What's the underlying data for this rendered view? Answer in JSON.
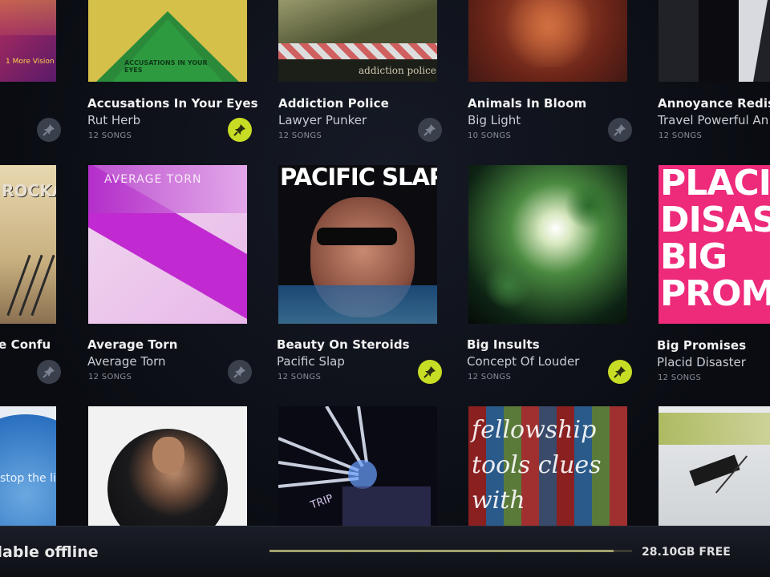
{
  "albums": [
    {
      "id": "r0c0",
      "title": "",
      "artist": "",
      "songs": "",
      "pinned": false,
      "cover_text": "1 More Vision"
    },
    {
      "id": "r0c1",
      "title": "Accusations In Your Eyes",
      "artist": "Rut Herb",
      "songs": "12 SONGS",
      "pinned": false,
      "cover_text": "ACCUSATIONS IN YOUR EYES"
    },
    {
      "id": "r0c2",
      "title": "Addiction Police",
      "artist": "Lawyer Punker",
      "songs": "12 SONGS",
      "pinned": true,
      "cover_text": "addiction police"
    },
    {
      "id": "r0c3",
      "title": "Animals In Bloom",
      "artist": "Big Light",
      "songs": "10 SONGS",
      "pinned": false,
      "cover_text": ""
    },
    {
      "id": "r0c4",
      "title": "Annoyance Redisc",
      "artist": "Travel Powerful An",
      "songs": "12 SONGS",
      "pinned": false,
      "cover_text": ""
    },
    {
      "id": "r1c0",
      "title": "e Confu",
      "artist": "",
      "songs": "",
      "pinned": false,
      "cover_text": "ROCKADE"
    },
    {
      "id": "r1c1",
      "title": "Average Torn",
      "artist": "Average Torn",
      "songs": "12 SONGS",
      "pinned": false,
      "cover_text": "AVERAGE TORN"
    },
    {
      "id": "r1c2",
      "title": "Beauty On Steroids",
      "artist": "Pacific Slap",
      "songs": "12 SONGS",
      "pinned": true,
      "cover_text": "PACIFIC SLAP"
    },
    {
      "id": "r1c3",
      "title": "Big Insults",
      "artist": "Concept Of Louder",
      "songs": "12 SONGS",
      "pinned": true,
      "cover_text": ""
    },
    {
      "id": "r1c4",
      "title": "Big Promises",
      "artist": "Placid Disaster",
      "songs": "12 SONGS",
      "pinned": false,
      "cover_text": "PLACID DISASTER BIG PROMISES"
    },
    {
      "id": "r2c0",
      "title": "",
      "artist": "",
      "songs": "",
      "pinned": false,
      "cover_text": "stop the lie"
    },
    {
      "id": "r2c1",
      "title": "",
      "artist": "",
      "songs": "",
      "pinned": false,
      "cover_text": ""
    },
    {
      "id": "r2c2",
      "title": "",
      "artist": "",
      "songs": "",
      "pinned": false,
      "cover_text": "TRIP"
    },
    {
      "id": "r2c3",
      "title": "",
      "artist": "",
      "songs": "",
      "pinned": false,
      "cover_text": "fellowship tools clues with"
    },
    {
      "id": "r2c4",
      "title": "",
      "artist": "",
      "songs": "",
      "pinned": false,
      "cover_text": ""
    }
  ],
  "bottom_bar": {
    "offline_label": "ilable offline",
    "storage_free": "28.10GB FREE",
    "storage_used_fraction": 0.95
  },
  "colors": {
    "pin_active": "#c7dc24",
    "pin_inactive": "#3a3f4c",
    "background": "#0b0d14"
  },
  "icons": {
    "pin": "pushpin-icon"
  }
}
